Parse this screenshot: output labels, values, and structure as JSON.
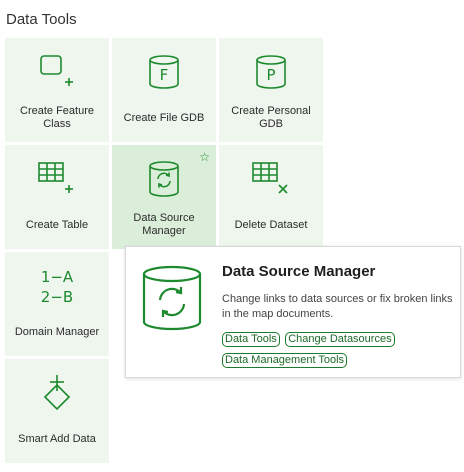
{
  "panel": {
    "title": "Data Tools"
  },
  "tiles": [
    {
      "label": "Create Feature Class"
    },
    {
      "label": "Create File GDB"
    },
    {
      "label": "Create Personal GDB"
    },
    {
      "label": "Create Table"
    },
    {
      "label": "Data Source Manager"
    },
    {
      "label": "Delete Dataset"
    },
    {
      "label": "Domain Manager"
    },
    {
      "label": "Smart Add Data"
    }
  ],
  "icons": {
    "create_feature_class": "rectangle-plus-icon",
    "create_file_gdb": "database-f-icon",
    "create_personal_gdb": "database-p-icon",
    "create_table": "table-plus-icon",
    "data_source_manager": "database-refresh-icon",
    "delete_dataset": "table-x-icon",
    "domain_manager": "mapping-icon",
    "smart_add_data": "diamond-plus-icon",
    "favorite": "star-icon"
  },
  "glyphs": {
    "file_gdb_letter": "F",
    "personal_gdb_letter": "P",
    "domain_line1": "1−A",
    "domain_line2": "2−B",
    "star": "☆"
  },
  "tooltip": {
    "title": "Data Source Manager",
    "description": "Change links to data sources or fix broken links in the map documents.",
    "tags": [
      "Data Tools",
      "Change Datasources",
      "Data Management Tools"
    ]
  },
  "colors": {
    "accent": "#1e8a2e",
    "tile_bg": "#eef6ee",
    "tile_selected_bg": "#daeeda"
  }
}
